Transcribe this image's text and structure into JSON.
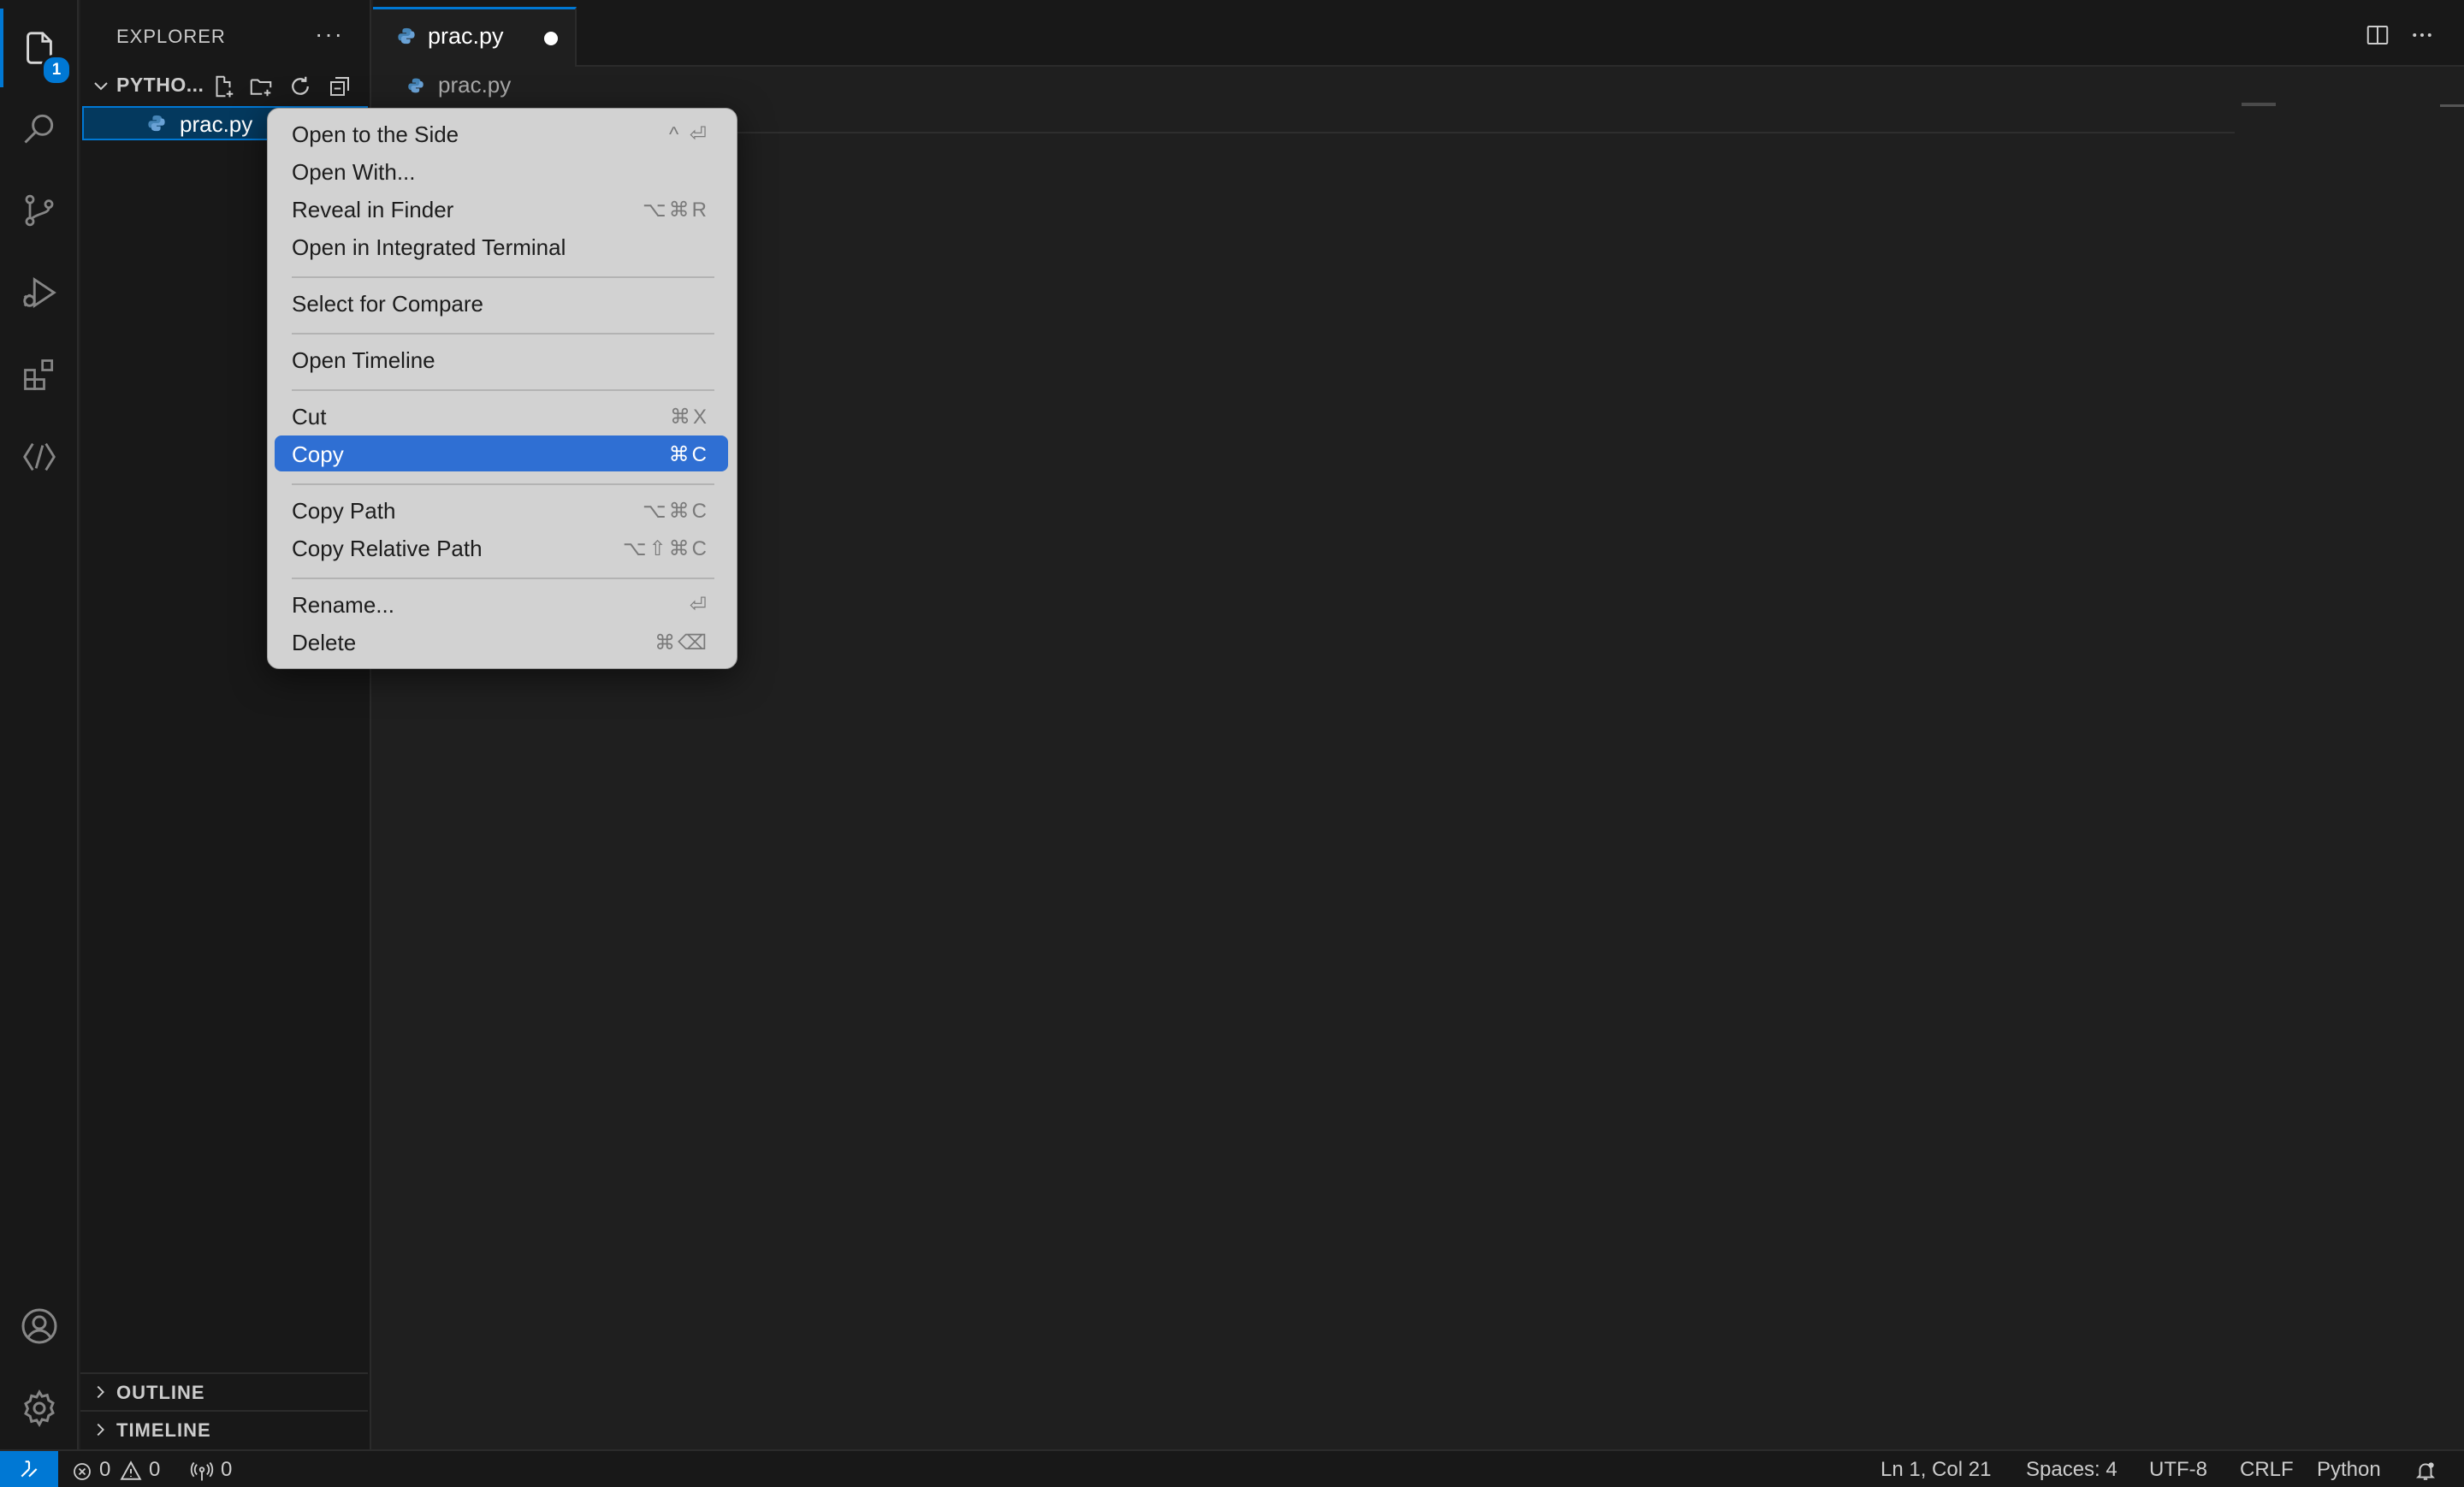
{
  "activity_bar": {
    "explorer_badge": "1"
  },
  "sidebar": {
    "title": "EXPLORER",
    "more": "···",
    "folder": "PYTHO...",
    "file": "prac.py",
    "sections": [
      {
        "label": "OUTLINE"
      },
      {
        "label": "TIMELINE"
      }
    ]
  },
  "editor": {
    "tab_label": "prac.py",
    "breadcrumb": "prac.py"
  },
  "context_menu": {
    "items": [
      {
        "label": "Open to the Side",
        "shortcut": "^ ⏎"
      },
      {
        "label": "Open With...",
        "shortcut": ""
      },
      {
        "label": "Reveal in Finder",
        "shortcut": "⌥⌘R"
      },
      {
        "label": "Open in Integrated Terminal",
        "shortcut": ""
      },
      {
        "label": "Select for Compare",
        "shortcut": ""
      },
      {
        "label": "Open Timeline",
        "shortcut": ""
      },
      {
        "label": "Cut",
        "shortcut": "⌘X"
      },
      {
        "label": "Copy",
        "shortcut": "⌘C",
        "selected": true
      },
      {
        "label": "Copy Path",
        "shortcut": "⌥⌘C"
      },
      {
        "label": "Copy Relative Path",
        "shortcut": "⌥⇧⌘C"
      },
      {
        "label": "Rename...",
        "shortcut": "⏎"
      },
      {
        "label": "Delete",
        "shortcut": "⌘⌫"
      }
    ]
  },
  "status_bar": {
    "errors": "0",
    "warnings": "0",
    "ports": "0",
    "position": "Ln 1, Col 21",
    "spaces": "Spaces: 4",
    "encoding": "UTF-8",
    "eol": "CRLF",
    "language": "Python"
  },
  "colors": {
    "accent": "#0078d4",
    "selection": "#2f6fd3",
    "editor_bg": "#1f1f1f",
    "sidebar_bg": "#181818",
    "menu_bg": "#d2d2d2"
  }
}
